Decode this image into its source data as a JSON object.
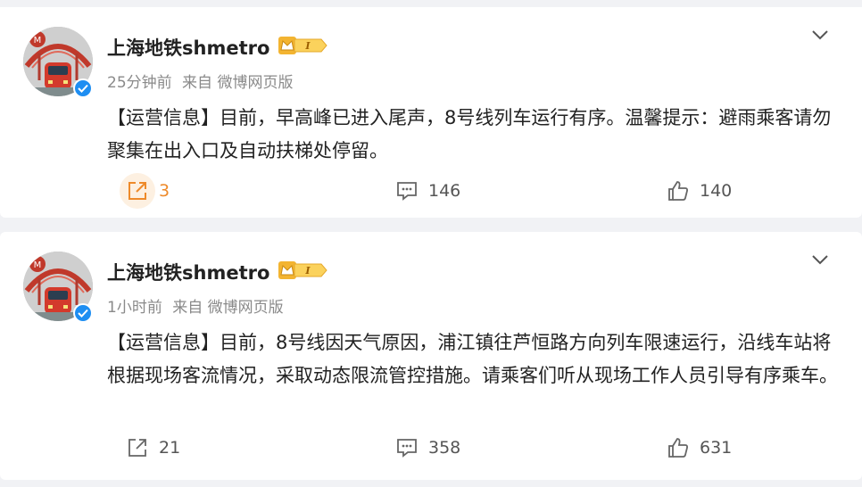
{
  "posts": [
    {
      "username": "上海地铁shmetro",
      "time": "25分钟前",
      "source": "来自 微博网页版",
      "content": "【运营信息】目前，早高峰已进入尾声，8号线列车运行有序。温馨提示：避雨乘客请勿聚集在出入口及自动扶梯处停留。",
      "reposts": "3",
      "comments": "146",
      "likes": "140",
      "repost_highlighted": true
    },
    {
      "username": "上海地铁shmetro",
      "time": "1小时前",
      "source": "来自 微博网页版",
      "content": "【运营信息】目前，8号线因天气原因，浦江镇往芦恒路方向列车限速运行，沿线车站将根据现场客流情况，采取动态限流管控措施。请乘客们听从现场工作人员引导有序乘车。",
      "reposts": "21",
      "comments": "358",
      "likes": "631",
      "repost_highlighted": false
    }
  ],
  "icons": {
    "verified": "verified-icon",
    "badge": "member-badge-icon",
    "chevron": "chevron-down-icon",
    "repost": "repost-icon",
    "comment": "comment-icon",
    "like": "like-icon"
  },
  "colors": {
    "accent_orange": "#ee8a2a",
    "verified_blue": "#1e8ef2",
    "meta_gray": "#8a8a8a"
  }
}
